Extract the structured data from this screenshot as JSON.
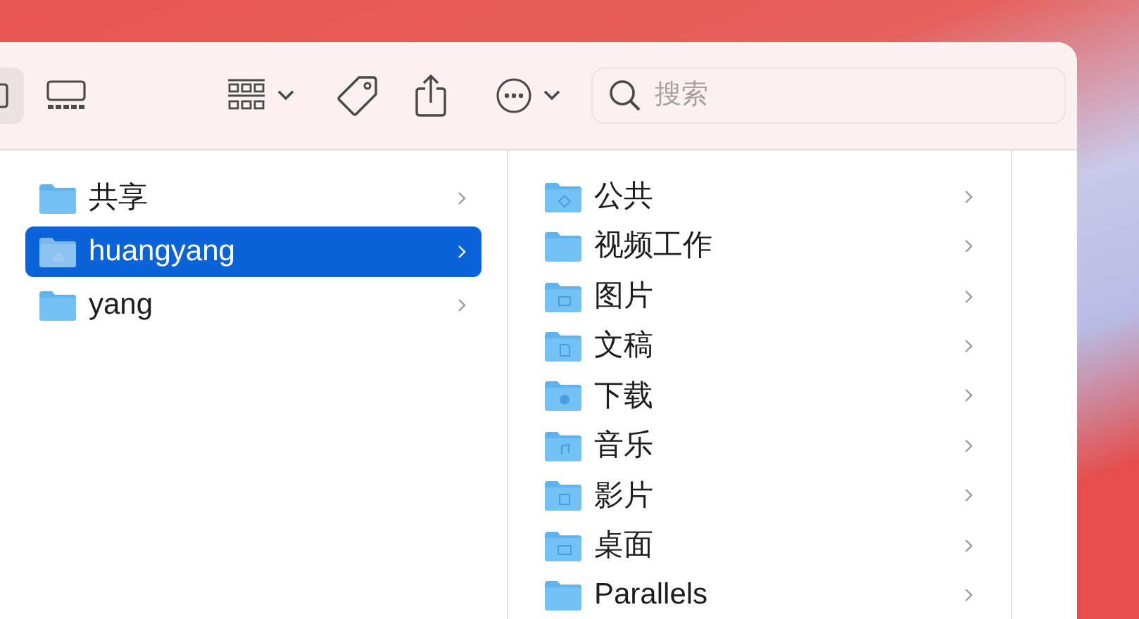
{
  "toolbar": {
    "view_buttons": [
      {
        "selected": true
      },
      {
        "selected": false
      }
    ],
    "search": {
      "placeholder": "搜索"
    }
  },
  "columns": [
    {
      "items": [
        {
          "name": "共享",
          "kind": "plain",
          "selected": false
        },
        {
          "name": "huangyang",
          "kind": "home",
          "selected": true
        },
        {
          "name": "yang",
          "kind": "plain",
          "selected": false
        }
      ]
    },
    {
      "items": [
        {
          "name": "公共",
          "kind": "public",
          "selected": false
        },
        {
          "name": "视频工作",
          "kind": "plain",
          "selected": false
        },
        {
          "name": "图片",
          "kind": "pictures",
          "selected": false
        },
        {
          "name": "文稿",
          "kind": "documents",
          "selected": false
        },
        {
          "name": "下载",
          "kind": "downloads",
          "selected": false
        },
        {
          "name": "音乐",
          "kind": "music",
          "selected": false
        },
        {
          "name": "影片",
          "kind": "movies",
          "selected": false
        },
        {
          "name": "桌面",
          "kind": "desktop",
          "selected": false
        },
        {
          "name": "Parallels",
          "kind": "plain",
          "selected": false
        }
      ]
    }
  ]
}
